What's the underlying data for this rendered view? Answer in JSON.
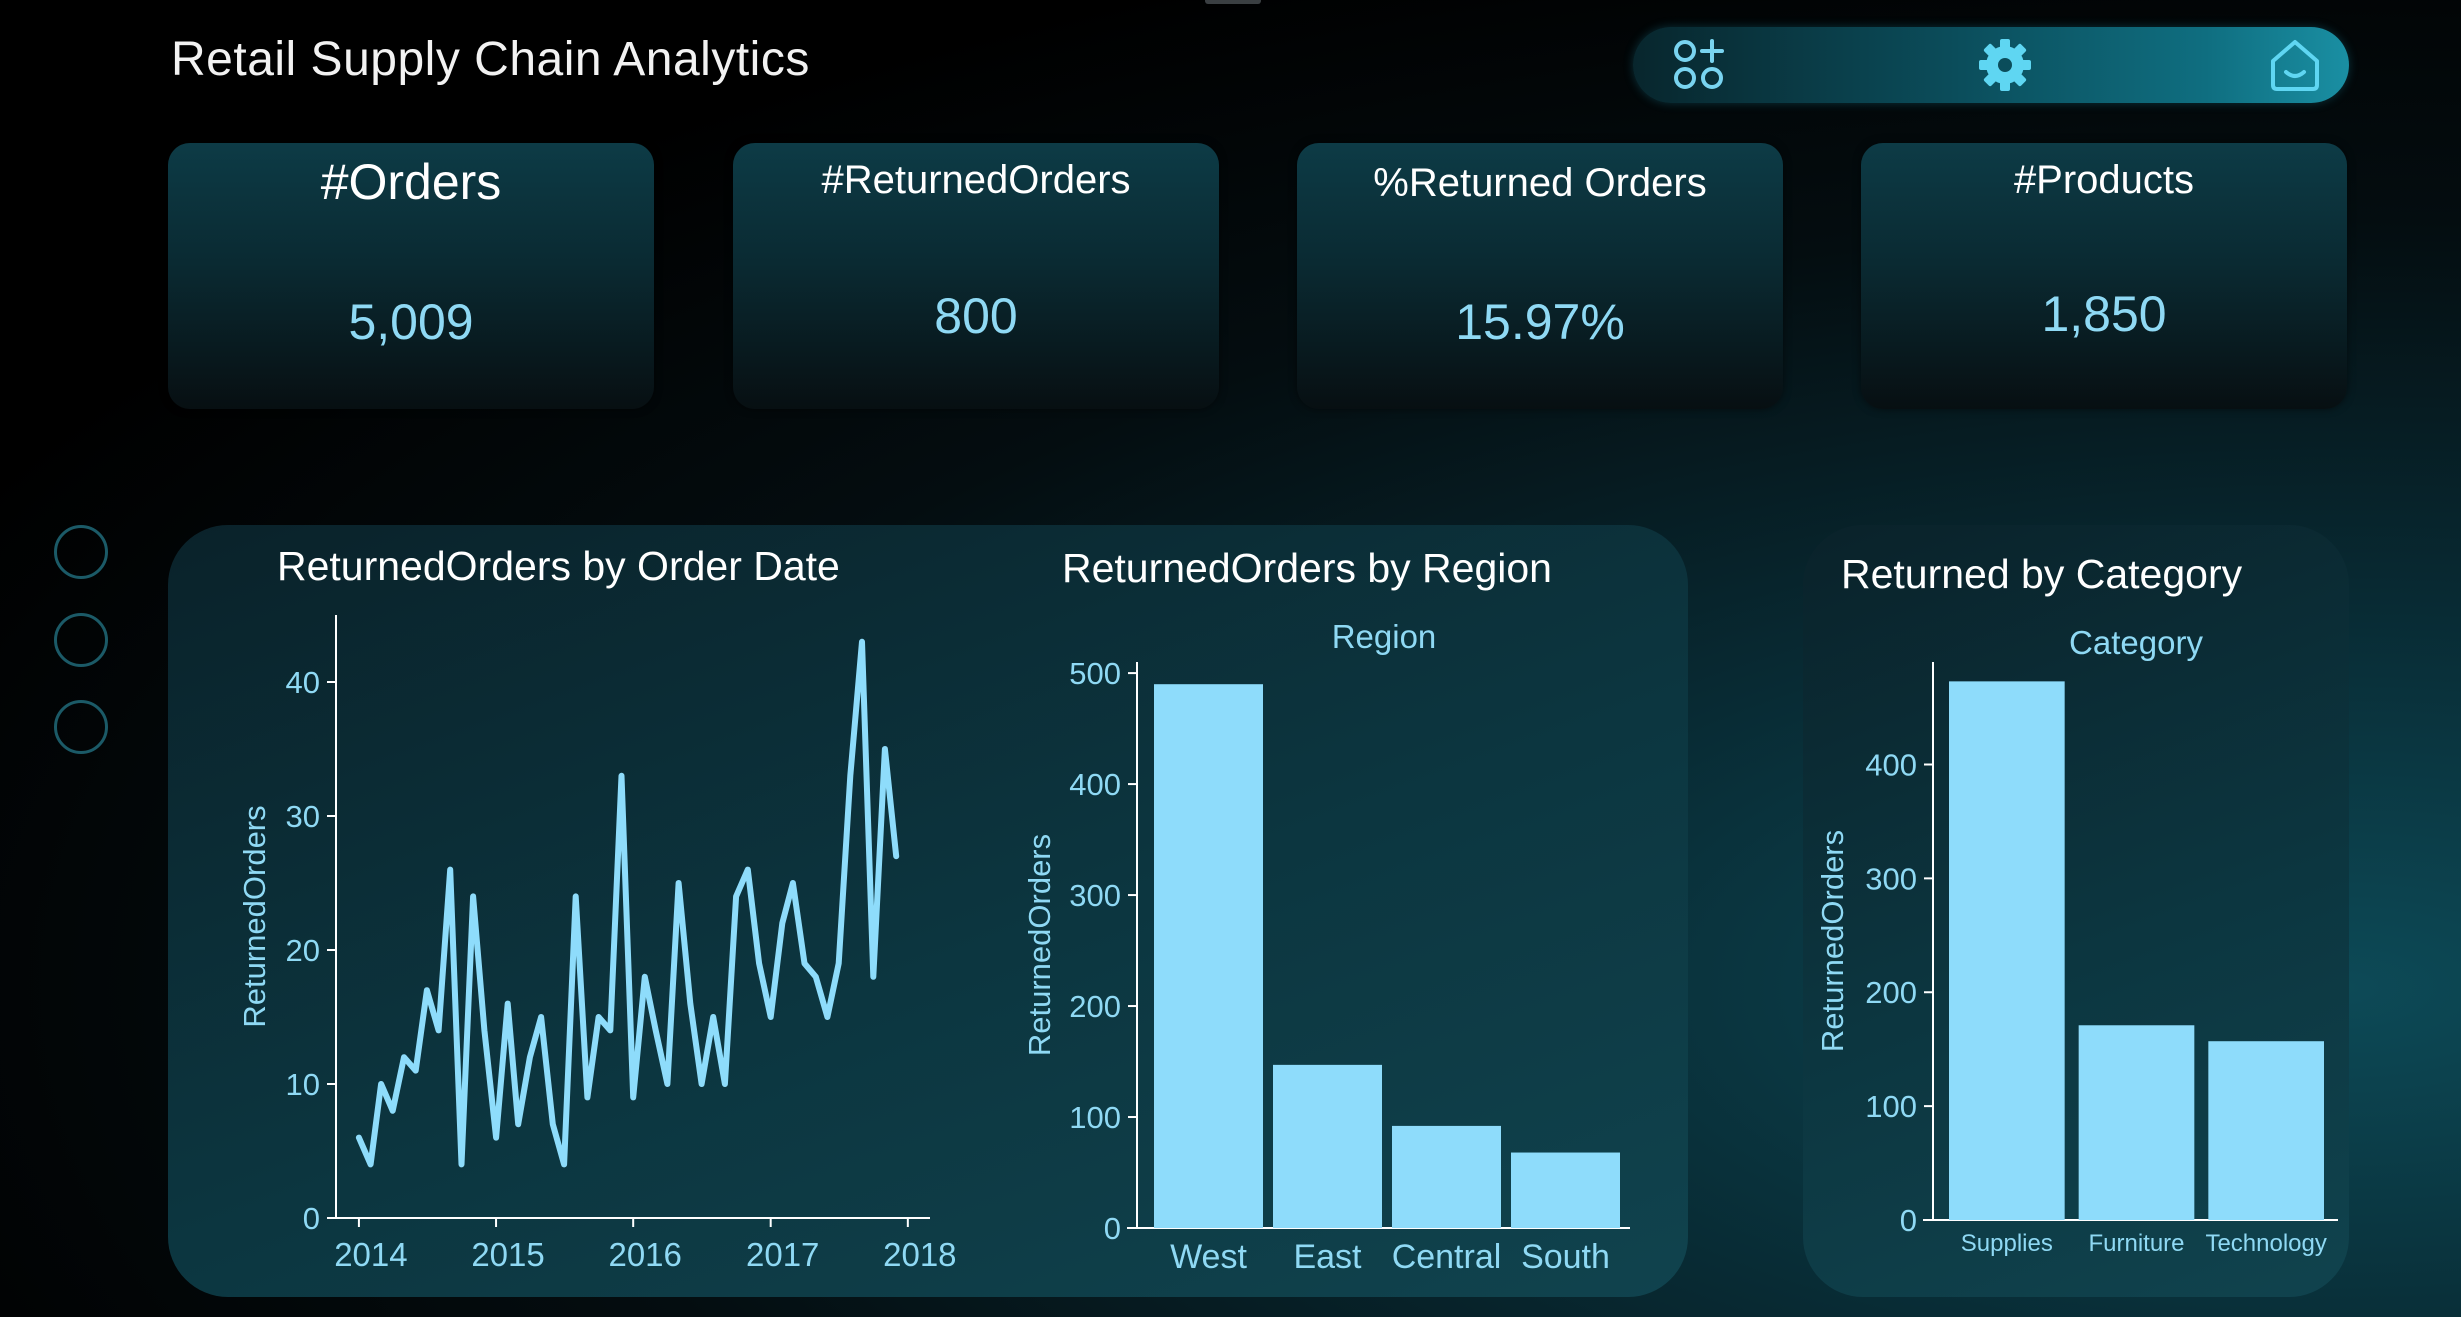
{
  "app_title": "Retail Supply Chain Analytics",
  "nav": {
    "icons": [
      "apps-add-icon",
      "gear-icon",
      "home-icon"
    ]
  },
  "kpis": [
    {
      "title": "#Orders",
      "value": "5,009"
    },
    {
      "title": "#ReturnedOrders",
      "value": "800"
    },
    {
      "title": "%Returned Orders",
      "value": "15.97%"
    },
    {
      "title": "#Products",
      "value": "1,850"
    }
  ],
  "colors": {
    "accent": "#8fd9f4",
    "bar": "#8edcfb",
    "line": "#8edcfb",
    "axis": "#ffffff"
  },
  "chart_data": [
    {
      "type": "line",
      "title": "ReturnedOrders by Order Date",
      "xlabel": "",
      "ylabel": "ReturnedOrders",
      "ylim": [
        0,
        45
      ],
      "xlim": [
        "2013-11-01",
        "2018-03-01"
      ],
      "yticks": [
        0,
        10,
        20,
        30,
        40
      ],
      "xticks": [
        {
          "label": "2014",
          "date": "2014-01-01"
        },
        {
          "label": "2015",
          "date": "2015-01-01"
        },
        {
          "label": "2016",
          "date": "2016-01-01"
        },
        {
          "label": "2017",
          "date": "2017-01-01"
        },
        {
          "label": "2018",
          "date": "2018-01-01"
        }
      ],
      "series": [
        {
          "x": [
            "2014-01-01",
            "2014-02-01",
            "2014-03-01",
            "2014-04-01",
            "2014-05-01",
            "2014-06-01",
            "2014-07-01",
            "2014-08-01",
            "2014-09-01",
            "2014-10-01",
            "2014-11-01",
            "2014-12-01",
            "2015-01-01",
            "2015-02-01",
            "2015-03-01",
            "2015-04-01",
            "2015-05-01",
            "2015-06-01",
            "2015-07-01",
            "2015-08-01",
            "2015-09-01",
            "2015-10-01",
            "2015-11-01",
            "2015-12-01",
            "2016-01-01",
            "2016-02-01",
            "2016-03-01",
            "2016-04-01",
            "2016-05-01",
            "2016-06-01",
            "2016-07-01",
            "2016-08-01",
            "2016-09-01",
            "2016-10-01",
            "2016-11-01",
            "2016-12-01",
            "2017-01-01",
            "2017-02-01",
            "2017-03-01",
            "2017-04-01",
            "2017-05-01",
            "2017-06-01",
            "2017-07-01",
            "2017-08-01",
            "2017-09-01",
            "2017-10-01",
            "2017-11-01",
            "2017-12-01"
          ],
          "values": [
            6,
            4,
            10,
            8,
            12,
            11,
            17,
            14,
            26,
            4,
            24,
            14,
            6,
            16,
            7,
            12,
            15,
            7,
            4,
            24,
            9,
            15,
            14,
            33,
            9,
            18,
            14,
            10,
            25,
            16,
            10,
            15,
            10,
            24,
            26,
            19,
            15,
            22,
            25,
            19,
            18,
            15,
            19,
            33,
            43,
            18,
            35,
            27
          ]
        }
      ]
    },
    {
      "type": "bar",
      "title": "ReturnedOrders by Region",
      "legend_title": "Region",
      "xlabel": "",
      "ylabel": "ReturnedOrders",
      "ylim": [
        0,
        510
      ],
      "yticks": [
        0,
        100,
        200,
        300,
        400,
        500
      ],
      "categories": [
        "West",
        "East",
        "Central",
        "South"
      ],
      "values": [
        490,
        147,
        92,
        68
      ]
    },
    {
      "type": "bar",
      "title": "Returned by Category",
      "legend_title": "Category",
      "xlabel": "",
      "ylabel": "ReturnedOrders",
      "ylim": [
        0,
        490
      ],
      "yticks": [
        0,
        100,
        200,
        300,
        400
      ],
      "categories": [
        "Supplies",
        "Furniture",
        "Technology"
      ],
      "values": [
        473,
        171,
        157
      ]
    }
  ]
}
